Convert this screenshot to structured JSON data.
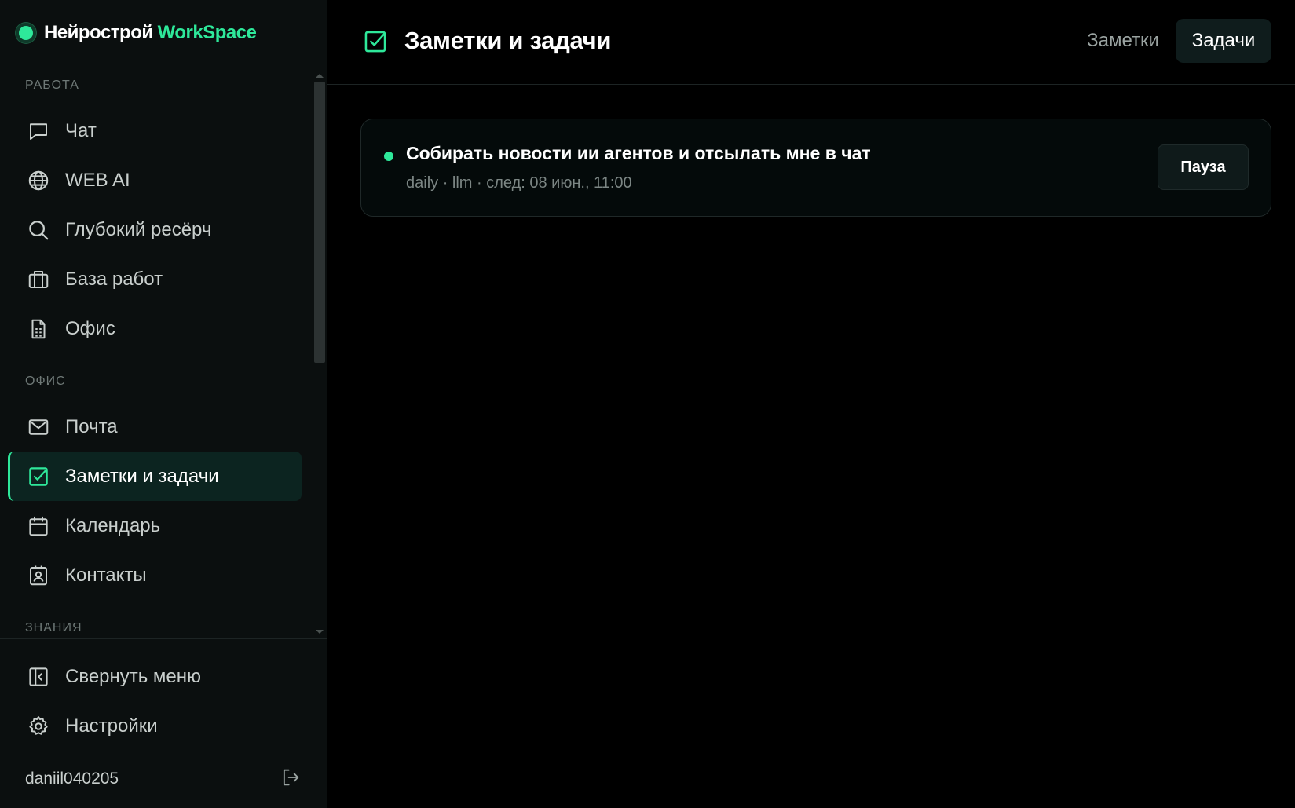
{
  "brand": {
    "name": "Нейрострой",
    "accent": "WorkSpace",
    "accent_color": "#2ee89a"
  },
  "sidebar": {
    "sections": [
      {
        "label": "РАБОТА",
        "items": [
          {
            "label": "Чат",
            "icon": "chat-icon"
          },
          {
            "label": "WEB AI",
            "icon": "globe-icon"
          },
          {
            "label": "Глубокий ресёрч",
            "icon": "search-icon"
          },
          {
            "label": "База работ",
            "icon": "briefcase-icon"
          },
          {
            "label": "Офис",
            "icon": "document-icon"
          }
        ]
      },
      {
        "label": "ОФИС",
        "items": [
          {
            "label": "Почта",
            "icon": "mail-icon"
          },
          {
            "label": "Заметки и задачи",
            "icon": "checkbox-icon",
            "active": true
          },
          {
            "label": "Календарь",
            "icon": "calendar-icon"
          },
          {
            "label": "Контакты",
            "icon": "contact-icon"
          }
        ]
      },
      {
        "label": "ЗНАНИЯ",
        "items": []
      }
    ],
    "bottom": [
      {
        "label": "Свернуть меню",
        "icon": "collapse-sidebar-icon"
      },
      {
        "label": "Настройки",
        "icon": "gear-icon"
      }
    ],
    "username": "daniil040205"
  },
  "header": {
    "title": "Заметки и задачи",
    "tabs": [
      {
        "label": "Заметки",
        "active": false
      },
      {
        "label": "Задачи",
        "active": true
      }
    ]
  },
  "tasks": [
    {
      "title": "Собирать новости ии агентов и отсылать мне в чат",
      "meta": "daily · llm · след: 08 июн., 11:00",
      "status_color": "#2ee89a",
      "action_label": "Пауза"
    }
  ]
}
